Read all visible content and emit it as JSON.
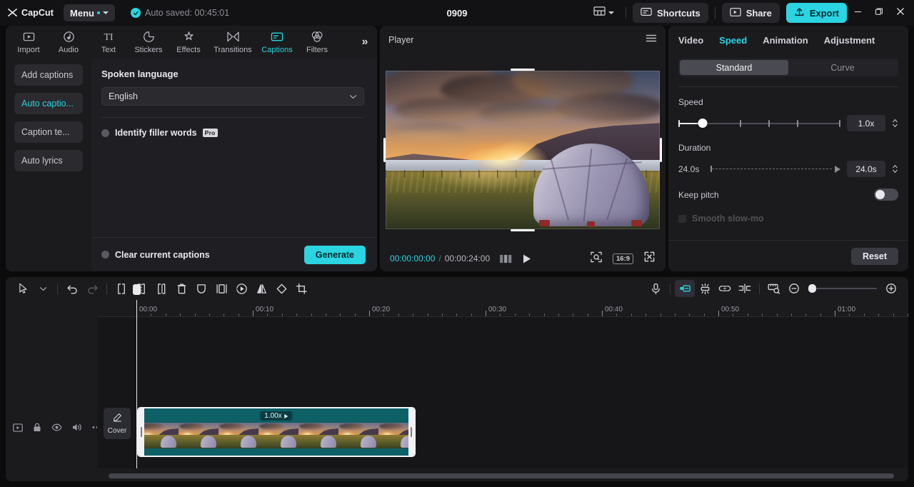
{
  "titlebar": {
    "brand": "CapCut",
    "menu_label": "Menu",
    "autosave": "Auto saved: 00:45:01",
    "project_title": "0909",
    "shortcuts_label": "Shortcuts",
    "share_label": "Share",
    "export_label": "Export",
    "accent": "#2ad4e0",
    "icons": {
      "layout": "layout-icon",
      "layout_caret": "chevron-down-icon",
      "shortcuts": "keyboard-icon",
      "share": "share-screen-icon",
      "export": "upload-icon",
      "minimize": "minimize-icon",
      "maximize": "restore-icon",
      "close": "close-icon"
    }
  },
  "left_panel": {
    "tabs": [
      {
        "label": "Import",
        "icon": "import-icon",
        "active": false
      },
      {
        "label": "Audio",
        "icon": "audio-icon",
        "active": false
      },
      {
        "label": "Text",
        "icon": "text-icon",
        "active": false
      },
      {
        "label": "Stickers",
        "icon": "sticker-icon",
        "active": false
      },
      {
        "label": "Effects",
        "icon": "effects-icon",
        "active": false
      },
      {
        "label": "Transitions",
        "icon": "transitions-icon",
        "active": false
      },
      {
        "label": "Captions",
        "icon": "captions-icon",
        "active": true
      },
      {
        "label": "Filters",
        "icon": "filters-icon",
        "active": false
      }
    ],
    "more_label": "»",
    "subnav": [
      {
        "label": "Add captions",
        "active": false
      },
      {
        "label": "Auto captio...",
        "active": true
      },
      {
        "label": "Caption te...",
        "active": false
      },
      {
        "label": "Auto lyrics",
        "active": false
      }
    ],
    "spoken_language_label": "Spoken language",
    "language_value": "English",
    "filler_words_label": "Identify filler words",
    "pro_badge": "Pro",
    "clear_captions_label": "Clear current captions",
    "generate_label": "Generate"
  },
  "player": {
    "title": "Player",
    "menu_icon": "hamburger-icon",
    "current_time": "00:00:00:00",
    "time_separator": "/",
    "total_time": "00:00:24:00",
    "frames_icon": "frames-icon",
    "play_icon": "play-icon",
    "zoom_icon": "zoom-fit-icon",
    "ratio_label": "16:9",
    "fullscreen_icon": "fullscreen-icon"
  },
  "right_panel": {
    "tabs": [
      {
        "label": "Video",
        "active": false
      },
      {
        "label": "Speed",
        "active": true
      },
      {
        "label": "Animation",
        "active": false
      },
      {
        "label": "Adjustment",
        "active": false
      }
    ],
    "mode_standard": "Standard",
    "mode_curve": "Curve",
    "speed_label": "Speed",
    "speed_value": "1.0x",
    "duration_label": "Duration",
    "duration_start": "24.0s",
    "duration_value": "24.0s",
    "keep_pitch_label": "Keep pitch",
    "keep_pitch_on": false,
    "smooth_slowmo_label": "Smooth slow-mo",
    "reset_label": "Reset"
  },
  "timeline": {
    "tools_left": [
      {
        "name": "select-cursor-icon",
        "dim": false
      },
      {
        "name": "cursor-dropdown-icon",
        "dim": false
      },
      {
        "name": "undo-icon",
        "dim": false
      },
      {
        "name": "redo-icon",
        "dim": true
      },
      {
        "name": "split-icon",
        "dim": false
      },
      {
        "name": "trim-left-icon",
        "dim": false
      },
      {
        "name": "trim-right-icon",
        "dim": false
      },
      {
        "name": "delete-icon",
        "dim": false
      },
      {
        "name": "mask-icon",
        "dim": false
      },
      {
        "name": "freeze-frame-icon",
        "dim": false
      },
      {
        "name": "speed-icon",
        "dim": false
      },
      {
        "name": "mirror-icon",
        "dim": false
      },
      {
        "name": "rotate-icon",
        "dim": false
      },
      {
        "name": "crop-icon",
        "dim": false
      }
    ],
    "tools_right": [
      {
        "name": "microphone-icon",
        "active": false
      },
      {
        "name": "clip-edit-icon",
        "active": true
      },
      {
        "name": "magnet-snap-icon",
        "active": false
      },
      {
        "name": "link-icon",
        "active": false
      },
      {
        "name": "mixer-icon",
        "active": false
      },
      {
        "name": "ruler-preview-icon",
        "active": false
      },
      {
        "name": "zoom-out-icon",
        "active": false
      },
      {
        "name": "zoom-in-icon",
        "active": false
      }
    ],
    "ruler_labels": [
      "00:00",
      "00:10",
      "00:20",
      "00:30",
      "00:40",
      "00:50",
      "01:00"
    ],
    "track_controls": [
      {
        "name": "video-track-icon"
      },
      {
        "name": "lock-icon"
      },
      {
        "name": "eye-visibility-icon"
      },
      {
        "name": "speaker-volume-icon"
      },
      {
        "name": "more-options-icon"
      }
    ],
    "cover_label": "Cover",
    "cover_icon": "pencil-icon",
    "clip_speed_badge": "1.00x",
    "playhead_time": "00:00"
  }
}
